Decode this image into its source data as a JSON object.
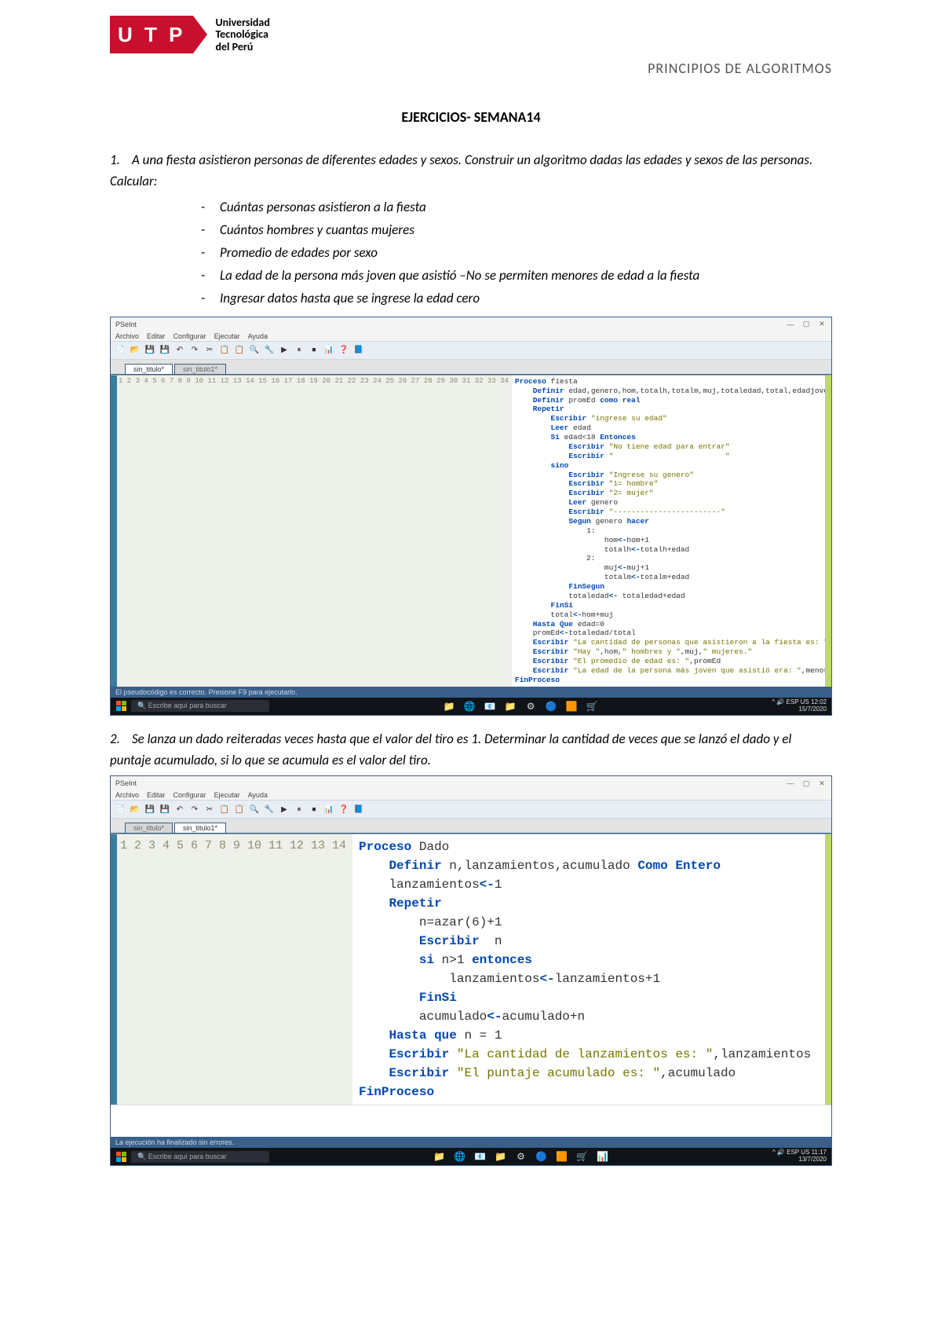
{
  "header": {
    "logo_letters": "U T P",
    "logo_text_lines": [
      "Universidad",
      "Tecnológica",
      "del Perú"
    ],
    "course_title": "PRINCIPIOS DE ALGORITMOS"
  },
  "title": "EJERCICIOS- SEMANA14",
  "problem1": {
    "number": "1.",
    "text": "A una fiesta asistieron personas de diferentes edades y sexos. Construir un algoritmo dadas las edades y sexos de las personas. Calcular:",
    "bullets": [
      "Cuántas personas asistieron a la fiesta",
      "Cuántos hombres y cuantas mujeres",
      "Promedio de edades por sexo",
      "La edad de la persona más joven que asistió –No se permiten menores de edad a la fiesta",
      "Ingresar datos hasta que se ingrese la edad cero"
    ]
  },
  "problem2": {
    "number": "2.",
    "text": "Se lanza un dado reiteradas veces hasta que el valor del tiro es 1. Determinar la cantidad de veces que se lanzó el dado y el puntaje acumulado, si lo que se acumula es el valor del tiro."
  },
  "ide": {
    "title_app": "PSeInt",
    "menus": [
      "Archivo",
      "Editar",
      "Configurar",
      "Ejecutar",
      "Ayuda"
    ],
    "tabs1": [
      "sin_titulo*",
      "sin_titulo1*"
    ],
    "tabs2": [
      "sin_titulo*",
      "sin_titulo1*"
    ],
    "status1": "El pseudocódigo es correcto. Presione F9 para ejecutarlo.",
    "status2": "La ejecución ha finalizado sin errores.",
    "search_placeholder": "Escribe aquí para buscar",
    "clock1_time": "12:02",
    "clock1_date": "15/7/2020",
    "clock1_lang": "ESP US",
    "clock2_time": "11:17",
    "clock2_date": "13/7/2020",
    "clock2_lang": "ESP US"
  },
  "code1_lines": [
    "1",
    "2",
    "3",
    "4",
    "5",
    "6",
    "7",
    "8",
    "9",
    "10",
    "11",
    "12",
    "13",
    "14",
    "15",
    "16",
    "17",
    "18",
    "19",
    "20",
    "21",
    "22",
    "23",
    "24",
    "25",
    "26",
    "27",
    "28",
    "29",
    "30",
    "31",
    "32",
    "33",
    "34"
  ],
  "code1": [
    {
      "t": "<kw>Proceso</kw> fiesta"
    },
    {
      "t": "    <kw>Definir</kw> edad,genero,hom,totalh,totalm,muj,totaledad,total,edadjoven <typ>Como Entero</typ>"
    },
    {
      "t": "    <kw>Definir</kw> promEd <typ>como real</typ>"
    },
    {
      "t": "    <kw>Repetir</kw>"
    },
    {
      "t": "        <kw>Escribir</kw> <str>\"ingrese su edad\"</str>"
    },
    {
      "t": "        <kw>Leer</kw> edad"
    },
    {
      "t": "        <kw>Si</kw> edad<18 <kw>Entonces</kw>"
    },
    {
      "t": "            <kw>Escribir</kw> <str>\"No tiene edad para entrar\"</str>"
    },
    {
      "t": "            <kw>Escribir</kw> <str>\"                         \"</str>"
    },
    {
      "t": "        <kw>sino</kw>"
    },
    {
      "t": "            <kw>Escribir</kw> <str>\"Ingrese su genero\"</str>"
    },
    {
      "t": "            <kw>Escribir</kw> <str>\"1= hombre\"</str>"
    },
    {
      "t": "            <kw>Escribir</kw> <str>\"2= mujer\"</str>"
    },
    {
      "t": "            <kw>Leer</kw> genero"
    },
    {
      "t": "            <kw>Escribir</kw> <str>\"------------------------\"</str>"
    },
    {
      "t": "            <kw>Segun</kw> genero <kw>hacer</kw>"
    },
    {
      "t": "                1:"
    },
    {
      "t": "                    hom<op><-</op>hom+1"
    },
    {
      "t": "                    totalh<op><-</op>totalh+edad"
    },
    {
      "t": "                2:"
    },
    {
      "t": "                    muj<op><-</op>muj+1"
    },
    {
      "t": "                    totalm<op><-</op>totalm+edad"
    },
    {
      "t": "            <kw>FinSegun</kw>"
    },
    {
      "t": "            totaledad<op><-</op> totaledad+edad"
    },
    {
      "t": "        <kw>FinSi</kw>"
    },
    {
      "t": "        total<op><-</op>hom+muj"
    },
    {
      "t": "    <kw>Hasta Que</kw> edad=0"
    },
    {
      "t": "    promEd<op><-</op>totaledad/total"
    },
    {
      "t": "    <kw>Escribir</kw> <str>\"La cantidad de personas que asistieron a la fiesta es: \"</str>, total"
    },
    {
      "t": "    <kw>Escribir</kw> <str>\"Hay \"</str>,hom,<str>\" hombres y \"</str>,muj,<str>\" mujeres.\"</str>"
    },
    {
      "t": "    <kw>Escribir</kw> <str>\"El promedio de edad es: \"</str>,promEd"
    },
    {
      "t": "    <kw>Escribir</kw> <str>\"La edad de la persona más joven que asistió era: \"</str>,menore"
    },
    {
      "t": "<kw>FinProceso</kw>"
    },
    {
      "t": ""
    }
  ],
  "code2_lines": [
    "1",
    "2",
    "3",
    "4",
    "5",
    "6",
    "7",
    "8",
    "9",
    "10",
    "11",
    "12",
    "13",
    "14"
  ],
  "code2": [
    {
      "t": "<kw>Proceso</kw> Dado"
    },
    {
      "t": "    <kw>Definir</kw> n,lanzamientos,acumulado <typ>Como Entero</typ>"
    },
    {
      "t": "    lanzamientos<op><-</op>1"
    },
    {
      "t": "    <kw>Repetir</kw>"
    },
    {
      "t": "        n=azar(<num-lit>6</num-lit>)+1"
    },
    {
      "t": "        <kw>Escribir</kw>  n"
    },
    {
      "t": "        <kw>si</kw> n>1 <kw>entonces</kw>"
    },
    {
      "t": "            lanzamientos<op><-</op>lanzamientos+1"
    },
    {
      "t": "        <kw>FinSi</kw>"
    },
    {
      "t": "        acumulado<op><-</op>acumulado+n"
    },
    {
      "t": "    <kw>Hasta que</kw> n = 1"
    },
    {
      "t": "    <kw>Escribir</kw> <str>\"La cantidad de lanzamientos es: \"</str>,lanzamientos"
    },
    {
      "t": "    <kw>Escribir</kw> <str>\"El puntaje acumulado es: \"</str>,acumulado"
    },
    {
      "t": "<kw>FinProceso</kw>"
    }
  ],
  "toolbar_icons": [
    "📄",
    "📂",
    "💾",
    "💾",
    "↶",
    "↷",
    "✂",
    "📋",
    "📋",
    "🔍",
    "🔧",
    "▶",
    "⏸",
    "⏹",
    "📊",
    "❓",
    "📘"
  ],
  "tray_icons1": [
    "📁",
    "🌐",
    "📧",
    "📁",
    "⚙",
    "🔵",
    "🟧",
    "🛒"
  ],
  "tray_icons2": [
    "📁",
    "🌐",
    "📧",
    "📁",
    "⚙",
    "🔵",
    "🟧",
    "🛒",
    "📊"
  ]
}
